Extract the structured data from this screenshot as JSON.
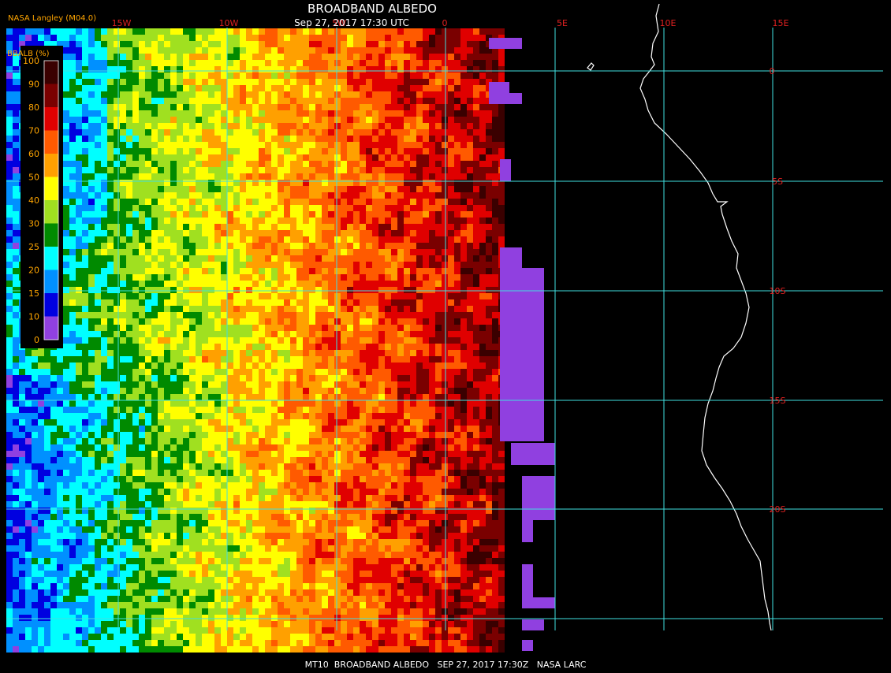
{
  "header": {
    "title": "BROADBAND ALBEDO",
    "subtitle": "Sep 27, 2017 17:30 UTC",
    "credit": "NASA Langley (M04.0)"
  },
  "footer": {
    "caption": "MT10  BROADBAND ALBEDO   SEP 27, 2017 17:30Z   NASA LARC"
  },
  "legend": {
    "label": "BBALB (%)",
    "ticks": [
      "100",
      "90",
      "80",
      "70",
      "60",
      "50",
      "40",
      "30",
      "25",
      "20",
      "15",
      "10",
      "0"
    ],
    "colors": [
      "#3a0000",
      "#7a0000",
      "#e00000",
      "#ff5a00",
      "#ffa000",
      "#ffff00",
      "#a0e020",
      "#008a00",
      "#00ffff",
      "#0090ff",
      "#0000e0",
      "#9040e0"
    ]
  },
  "grid": {
    "lon_labels": [
      "15W",
      "10W",
      "5W",
      "0",
      "5E",
      "10E",
      "15E"
    ],
    "lat_labels": [
      "0",
      "5S",
      "10S",
      "15S",
      "20S"
    ],
    "line_color": "#40e0e0",
    "label_color": "#e02020"
  },
  "colors": {
    "title": "#ffffff",
    "credit": "#ffa500",
    "coastline": "#ffffff",
    "missing_data": "#9040e0"
  }
}
